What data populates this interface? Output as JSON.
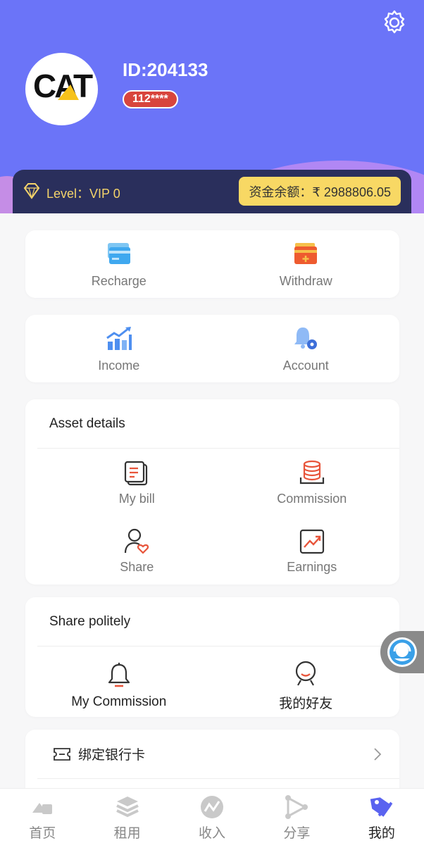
{
  "profile": {
    "id_label": "ID:204133",
    "phone_masked": "112****",
    "avatar_text": "CAT"
  },
  "level": {
    "label": "Level：VIP 0",
    "balance": "资金余额：₹ 2988806.05"
  },
  "actions_row1": [
    {
      "label": "Recharge",
      "icon": "card-icon"
    },
    {
      "label": "Withdraw",
      "icon": "wallet-icon"
    }
  ],
  "actions_row2": [
    {
      "label": "Income",
      "icon": "chart-icon"
    },
    {
      "label": "Account",
      "icon": "bell-gear-icon"
    }
  ],
  "asset": {
    "title": "Asset details",
    "items": [
      {
        "label": "My bill",
        "icon": "bill-icon"
      },
      {
        "label": "Commission",
        "icon": "coins-icon"
      },
      {
        "label": "Share",
        "icon": "user-heart-icon"
      },
      {
        "label": "Earnings",
        "icon": "trend-icon"
      }
    ]
  },
  "share": {
    "title": "Share politely",
    "items": [
      {
        "label": "My Commission",
        "icon": "bell-icon"
      },
      {
        "label": "我的好友",
        "icon": "friend-icon"
      }
    ]
  },
  "bank": {
    "label": "绑定银行卡"
  },
  "tabs": [
    {
      "label": "首页",
      "icon": "home-icon",
      "active": false
    },
    {
      "label": "租用",
      "icon": "layers-icon",
      "active": false
    },
    {
      "label": "收入",
      "icon": "income-icon",
      "active": false
    },
    {
      "label": "分享",
      "icon": "share-icon",
      "active": false
    },
    {
      "label": "我的",
      "icon": "tag-icon",
      "active": true
    }
  ],
  "colors": {
    "header": "#6b74f8",
    "accent": "#f8d864",
    "active_tab": "#5a63f0"
  }
}
